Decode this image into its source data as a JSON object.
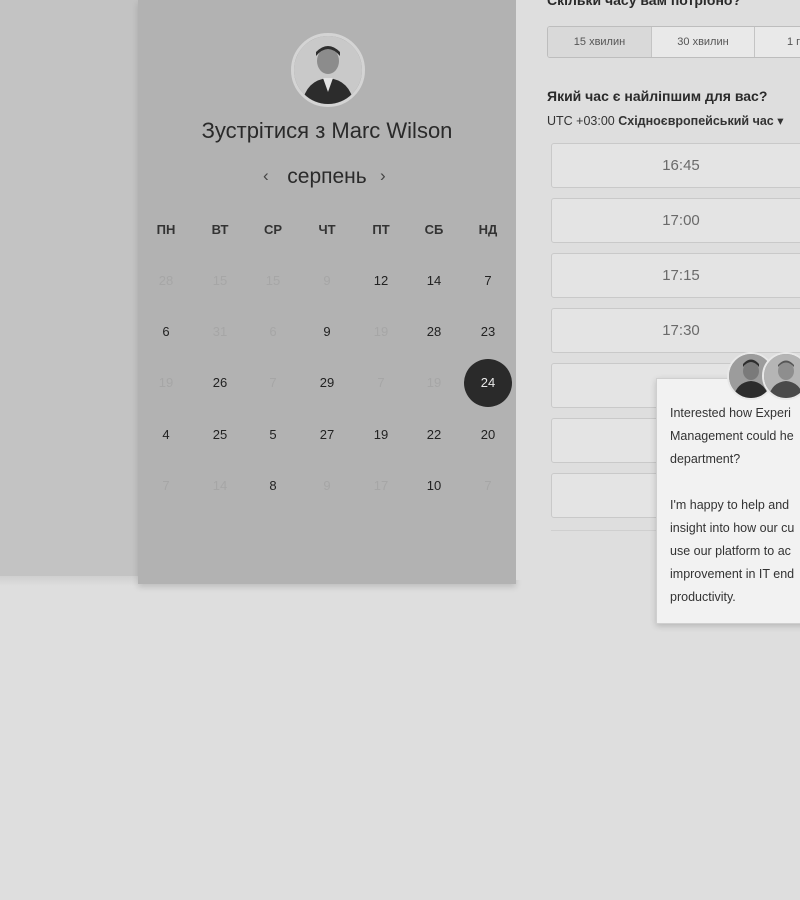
{
  "calendar": {
    "title": "Зустрітися з Marc Wilson",
    "month": "серпень",
    "prev_icon": "‹",
    "next_icon": "›",
    "weekdays": [
      "ПН",
      "ВТ",
      "СР",
      "ЧТ",
      "ПТ",
      "СБ",
      "НД"
    ],
    "weeks": [
      [
        {
          "d": "28",
          "on": false
        },
        {
          "d": "15",
          "on": false
        },
        {
          "d": "15",
          "on": false
        },
        {
          "d": "9",
          "on": false
        },
        {
          "d": "12",
          "on": true
        },
        {
          "d": "14",
          "on": true
        },
        {
          "d": "7",
          "on": true
        }
      ],
      [
        {
          "d": "6",
          "on": true
        },
        {
          "d": "31",
          "on": false
        },
        {
          "d": "6",
          "on": false
        },
        {
          "d": "9",
          "on": true
        },
        {
          "d": "19",
          "on": false
        },
        {
          "d": "28",
          "on": true
        },
        {
          "d": "23",
          "on": true
        }
      ],
      [
        {
          "d": "19",
          "on": false
        },
        {
          "d": "26",
          "on": true
        },
        {
          "d": "7",
          "on": false
        },
        {
          "d": "29",
          "on": true
        },
        {
          "d": "7",
          "on": false
        },
        {
          "d": "19",
          "on": false
        },
        {
          "d": "24",
          "on": true,
          "selected": true
        }
      ],
      [
        {
          "d": "4",
          "on": true
        },
        {
          "d": "25",
          "on": true
        },
        {
          "d": "5",
          "on": true
        },
        {
          "d": "27",
          "on": true
        },
        {
          "d": "19",
          "on": true
        },
        {
          "d": "22",
          "on": true
        },
        {
          "d": "20",
          "on": true
        }
      ],
      [
        {
          "d": "7",
          "on": false
        },
        {
          "d": "14",
          "on": false
        },
        {
          "d": "8",
          "on": true
        },
        {
          "d": "9",
          "on": false
        },
        {
          "d": "17",
          "on": false
        },
        {
          "d": "10",
          "on": true
        },
        {
          "d": "7",
          "on": false
        }
      ]
    ]
  },
  "booking": {
    "duration_question": "Скільки часу вам потрібно?",
    "durations": [
      "15 хвилин",
      "30 хвилин",
      "1 г"
    ],
    "time_question": "Який час є найліпшим для вас?",
    "timezone_offset": "UTC +03:00",
    "timezone_name": "Східноєвропейський час",
    "timezone_caret": "▾",
    "slots": [
      "16:45",
      "17:00",
      "17:15",
      "17:30",
      "",
      "",
      ""
    ]
  },
  "chat": {
    "message": "Interested how Experi\nManagement could he\ndepartment?\n\nI'm happy to help and\ninsight into how our cu\nuse our platform to ac\nimprovement in IT end\nproductivity."
  },
  "colors": {
    "selected_day_bg": "#2a2a2a",
    "panel_bg": "#b2b2b2"
  }
}
